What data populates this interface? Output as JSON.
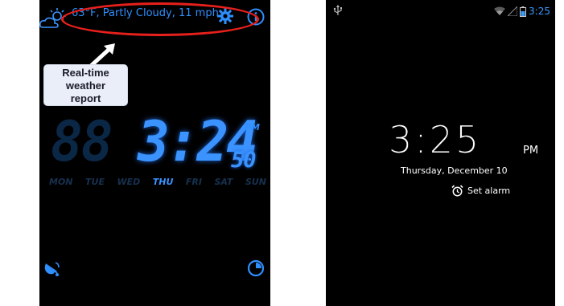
{
  "left_phone": {
    "weather": {
      "text": "63°F, Partly Cloudy, 11 mph",
      "icon": "partly-cloudy-icon"
    },
    "toolbar": {
      "settings_icon": "gear-icon",
      "info_icon": "info-icon"
    },
    "annotation": {
      "label_lines": [
        "Real-time",
        "weather",
        "report"
      ],
      "highlight_color": "#e8201c"
    },
    "clock": {
      "ghost_digits": "88",
      "time": "3:24",
      "seconds": "50",
      "period": "PM"
    },
    "days": [
      "MON",
      "TUE",
      "WED",
      "THU",
      "FRI",
      "SAT",
      "SUN"
    ],
    "active_day": "THU",
    "bottom": {
      "alarm_icon": "bell-icon",
      "timer_icon": "timer-icon"
    },
    "accent_color": "#3a93ff"
  },
  "right_phone": {
    "status_bar": {
      "usb_icon": "usb-icon",
      "wifi_icon": "wifi-icon",
      "signal_icon": "signal-icon",
      "battery_icon": "battery-icon",
      "time": "3:25"
    },
    "lock_screen": {
      "time": "3:25",
      "period": "PM",
      "date": "Thursday, December 10",
      "alarm_label": "Set alarm",
      "alarm_icon": "alarm-clock-icon"
    },
    "status_color": "#3a9bff"
  }
}
